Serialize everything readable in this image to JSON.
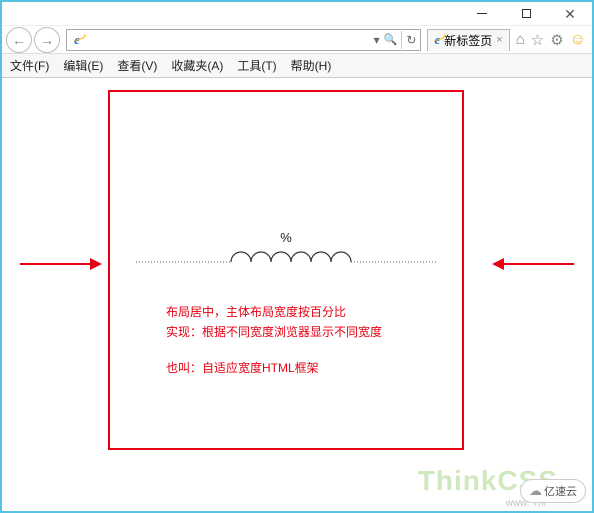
{
  "window": {
    "title": "新标签页",
    "tab_close": "×"
  },
  "menu": {
    "file": "文件(F)",
    "edit": "编辑(E)",
    "view": "查看(V)",
    "favorites": "收藏夹(A)",
    "tools": "工具(T)",
    "help": "帮助(H)"
  },
  "address": {
    "value": "",
    "search_icon": "🔍",
    "dropdown": "▾",
    "refresh": "↻"
  },
  "nav": {
    "back": "←",
    "forward": "→"
  },
  "toolbar_icons": {
    "home": "⌂",
    "star": "☆",
    "gear": "⚙"
  },
  "content": {
    "percent": "%",
    "line1": "布局居中，主体布局宽度按百分比",
    "line2": "实现：根据不同宽度浏览器显示不同宽度",
    "line3": "也叫：自适应宽度HTML框架"
  },
  "watermark": {
    "think": "ThinkCSS",
    "sub": "www. Thi",
    "yisu": "亿速云"
  }
}
